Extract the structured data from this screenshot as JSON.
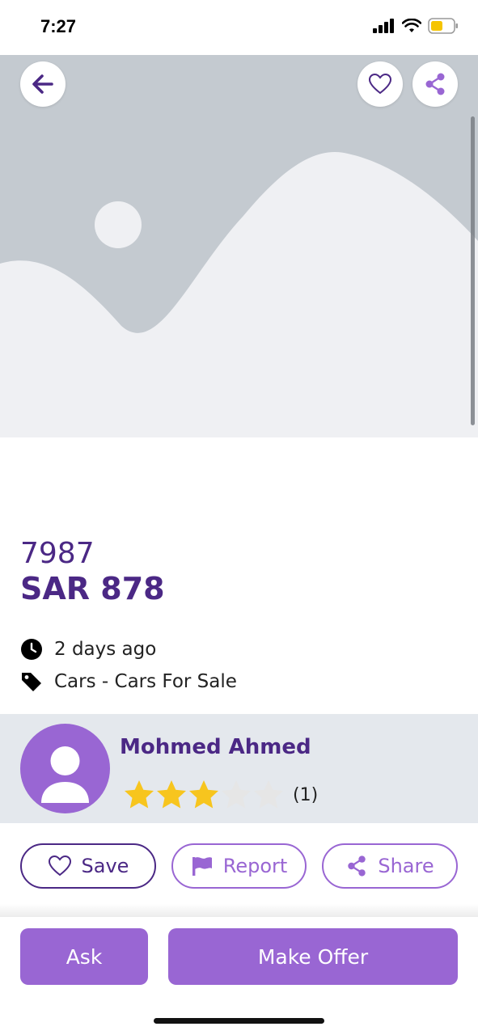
{
  "status_bar": {
    "time": "7:27"
  },
  "listing": {
    "title": "7987",
    "price": "SAR 878",
    "posted": "2 days ago",
    "category": "Cars - Cars For Sale"
  },
  "seller": {
    "name": "Mohmed Ahmed",
    "rating": 3,
    "rating_max": 5,
    "rating_count": "(1)"
  },
  "actions": {
    "save_label": "Save",
    "report_label": "Report",
    "share_label": "Share"
  },
  "footer": {
    "ask_label": "Ask",
    "offer_label": "Make Offer"
  },
  "colors": {
    "primary": "#4b2885",
    "accent": "#9966d3",
    "star_filled": "#f7c51e",
    "star_empty": "#e6e6e6",
    "seller_band": "#e4e8ed",
    "hero_bg": "#c4cad0",
    "battery": "#f5c400"
  },
  "icons": {
    "back": "arrow-left-icon",
    "favorite": "heart-outline-icon",
    "share": "share-icon",
    "clock": "clock-icon",
    "tag": "tag-icon",
    "flag": "flag-icon",
    "avatar": "user-avatar-icon"
  }
}
